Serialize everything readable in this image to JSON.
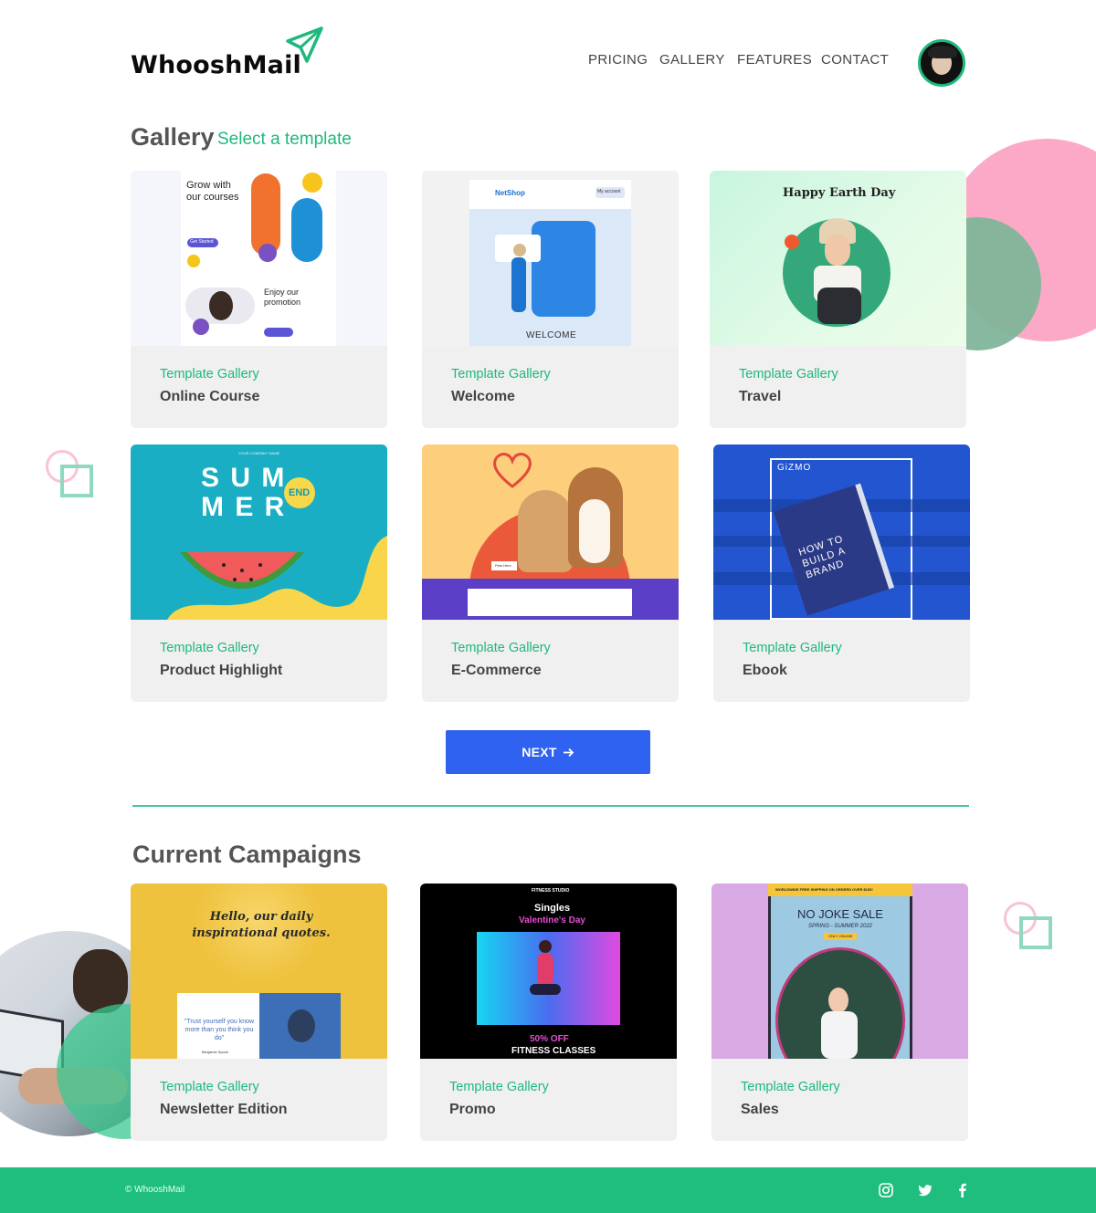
{
  "brand": {
    "name": "WhooshMail",
    "accent": "#1db97c",
    "footer_color": "#1fbe7f",
    "button_color": "#2f62f0"
  },
  "nav": {
    "items": [
      "PRICING",
      "GALLERY",
      "FEATURES",
      "CONTACT"
    ]
  },
  "gallery": {
    "title": "Gallery",
    "subtitle": "Select a template",
    "cards": [
      {
        "category": "Template Gallery",
        "title": "Online Course"
      },
      {
        "category": "Template Gallery",
        "title": "Welcome"
      },
      {
        "category": "Template Gallery",
        "title": "Travel"
      },
      {
        "category": "Template Gallery",
        "title": "Product Highlight"
      },
      {
        "category": "Template Gallery",
        "title": "E-Commerce"
      },
      {
        "category": "Template Gallery",
        "title": "Ebook"
      }
    ],
    "next_label": "NEXT"
  },
  "thumbs": {
    "course": {
      "heading1": "Grow with our courses",
      "heading2": "Enjoy our promotion",
      "btn": "Get Started"
    },
    "welcome": {
      "shop": "NetShop",
      "account": "My account",
      "caption": "WELCOME"
    },
    "travel": {
      "heading": "Happy Earth Day"
    },
    "summer": {
      "company": "YOUR COMPANY NAME",
      "line1": "S U M",
      "line2": "M E R",
      "badge": "END"
    },
    "ecom": {
      "tag": "Pets Hero"
    },
    "ebook": {
      "brand": "GiZMO",
      "title": "HOW TO BUILD A BRAND"
    },
    "newsletter": {
      "quote": "Hello, our daily inspirational quotes.",
      "inner": "\"Trust yourself you know more than you think you do\"",
      "author": "Benjamin Spock"
    },
    "promo": {
      "studio": "FITNESS STUDIO",
      "line1": "Singles",
      "line2": "Valentine's Day",
      "offer": "50% OFF",
      "classes": "FITNESS CLASSES"
    },
    "sales": {
      "banner": "WORLDWIDE FREE SHIPPING ON ORDERS OVER $100!",
      "title": "NO JOKE SALE",
      "sub": "SPRING - SUMMER 2022",
      "badge": "ONLY ONLINE"
    }
  },
  "campaigns": {
    "title": "Current Campaigns",
    "cards": [
      {
        "category": "Template Gallery",
        "title": "Newsletter Edition"
      },
      {
        "category": "Template Gallery",
        "title": "Promo"
      },
      {
        "category": "Template Gallery",
        "title": "Sales"
      }
    ]
  },
  "footer": {
    "copyright": "© WhooshMail",
    "social": [
      "instagram-icon",
      "twitter-icon",
      "facebook-icon"
    ]
  }
}
